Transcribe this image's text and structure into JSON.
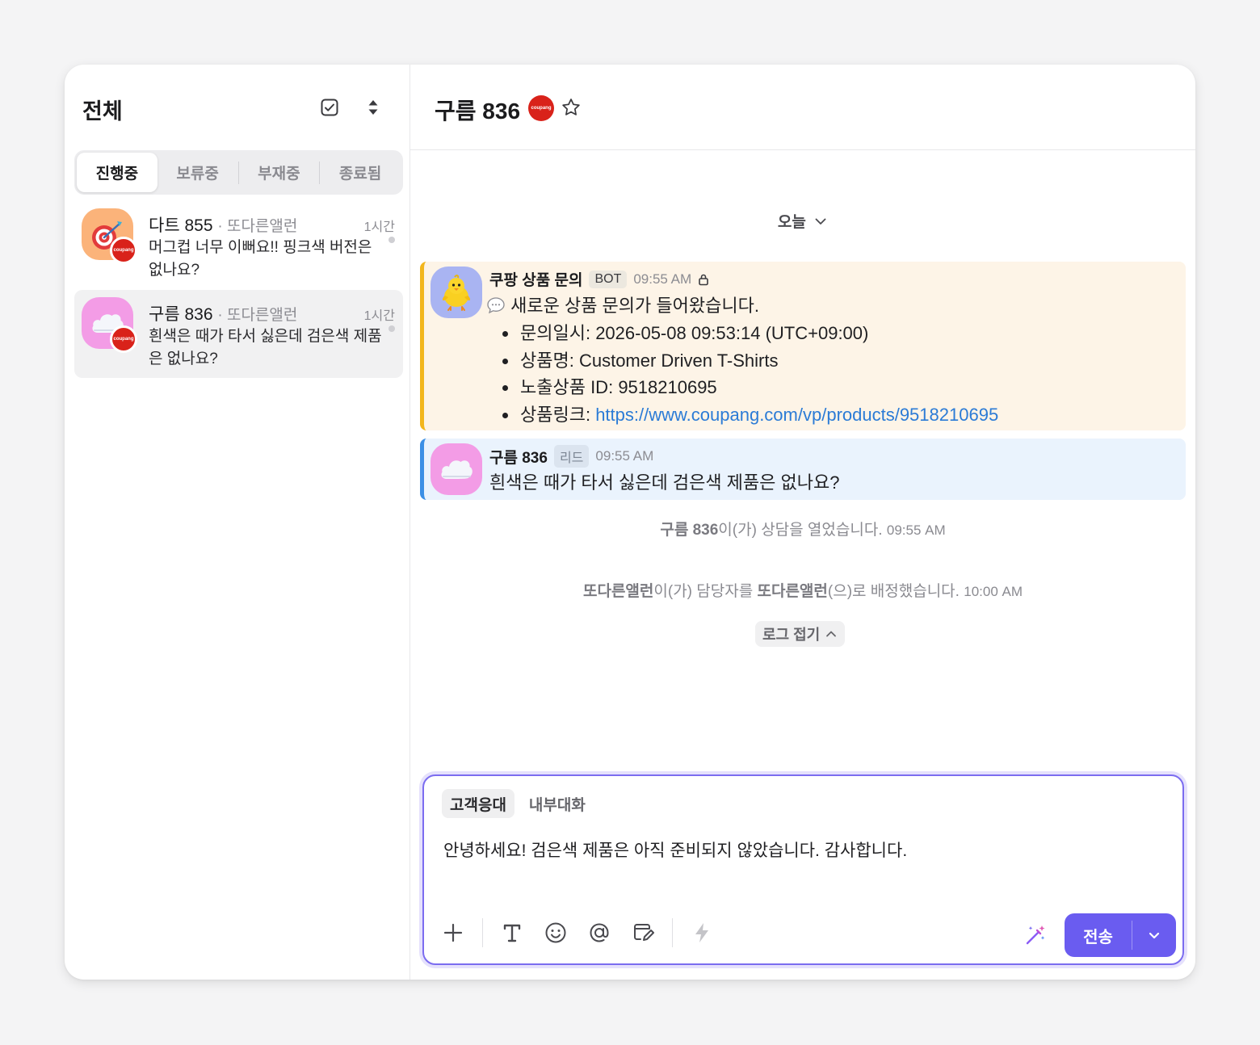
{
  "sidebar": {
    "title": "전체",
    "tabs": [
      {
        "label": "진행중",
        "active": true
      },
      {
        "label": "보류중",
        "active": false
      },
      {
        "label": "부재중",
        "active": false
      },
      {
        "label": "종료됨",
        "active": false
      }
    ],
    "chats": [
      {
        "name": "다트 855",
        "assignee": "· 또다른앨런",
        "time": "1시간",
        "message": "머그컵 너무 이뻐요!! 핑크색 버전은 없나요?",
        "avatar_icon": "dart-target-icon",
        "badge": "coupang"
      },
      {
        "name": "구름 836",
        "assignee": "· 또다른앨런",
        "time": "1시간",
        "message": "흰색은 때가 타서 싫은데 검은색 제품은 없나요?",
        "avatar_icon": "cloud-icon",
        "badge": "coupang"
      }
    ]
  },
  "header": {
    "title": "구름 836",
    "badge": "coupang"
  },
  "conversation": {
    "date_label": "오늘",
    "bot_message": {
      "author": "쿠팡 상품 문의",
      "tag": "BOT",
      "time": "09:55 AM",
      "intro": "새로운 상품 문의가 들어왔습니다.",
      "items": [
        {
          "label": "문의일시: ",
          "value": "2026-05-08 09:53:14 (UTC+09:00)"
        },
        {
          "label": "상품명: ",
          "value": "Customer Driven T-Shirts"
        },
        {
          "label": "노출상품 ID: ",
          "value": "9518210695"
        },
        {
          "label": "상품링크: ",
          "value": "https://www.coupang.com/vp/products/9518210695"
        }
      ]
    },
    "user_message": {
      "author": "구름 836",
      "tag": "리드",
      "time": "09:55 AM",
      "text": "흰색은 때가 타서 싫은데 검은색 제품은 없나요?"
    },
    "system_logs": [
      {
        "bold": "구름 836",
        "text": "이(가) 상담을 열었습니다.",
        "time": "09:55 AM"
      },
      {
        "bold": "또다른앨런",
        "text": "이(가) 담당자를 ",
        "bold2": "또다른앨런",
        "text2": "(으)로 배정했습니다.",
        "time": "10:00 AM"
      }
    ],
    "log_toggle": "로그 접기"
  },
  "composer": {
    "tabs": [
      {
        "label": "고객응대",
        "active": true
      },
      {
        "label": "내부대화",
        "active": false
      }
    ],
    "text": "안녕하세요! 검은색 제품은 아직 준비되지 않았습니다. 감사합니다.",
    "send_label": "전송"
  },
  "colors": {
    "accent": "#6a5cf0",
    "bot_bg": "#fdf4e7",
    "bot_border": "#f2b61d",
    "user_bg": "#eaf3fd",
    "user_border": "#3b8fe5",
    "link": "#2b7bd6",
    "coupang_red": "#d9221a"
  }
}
